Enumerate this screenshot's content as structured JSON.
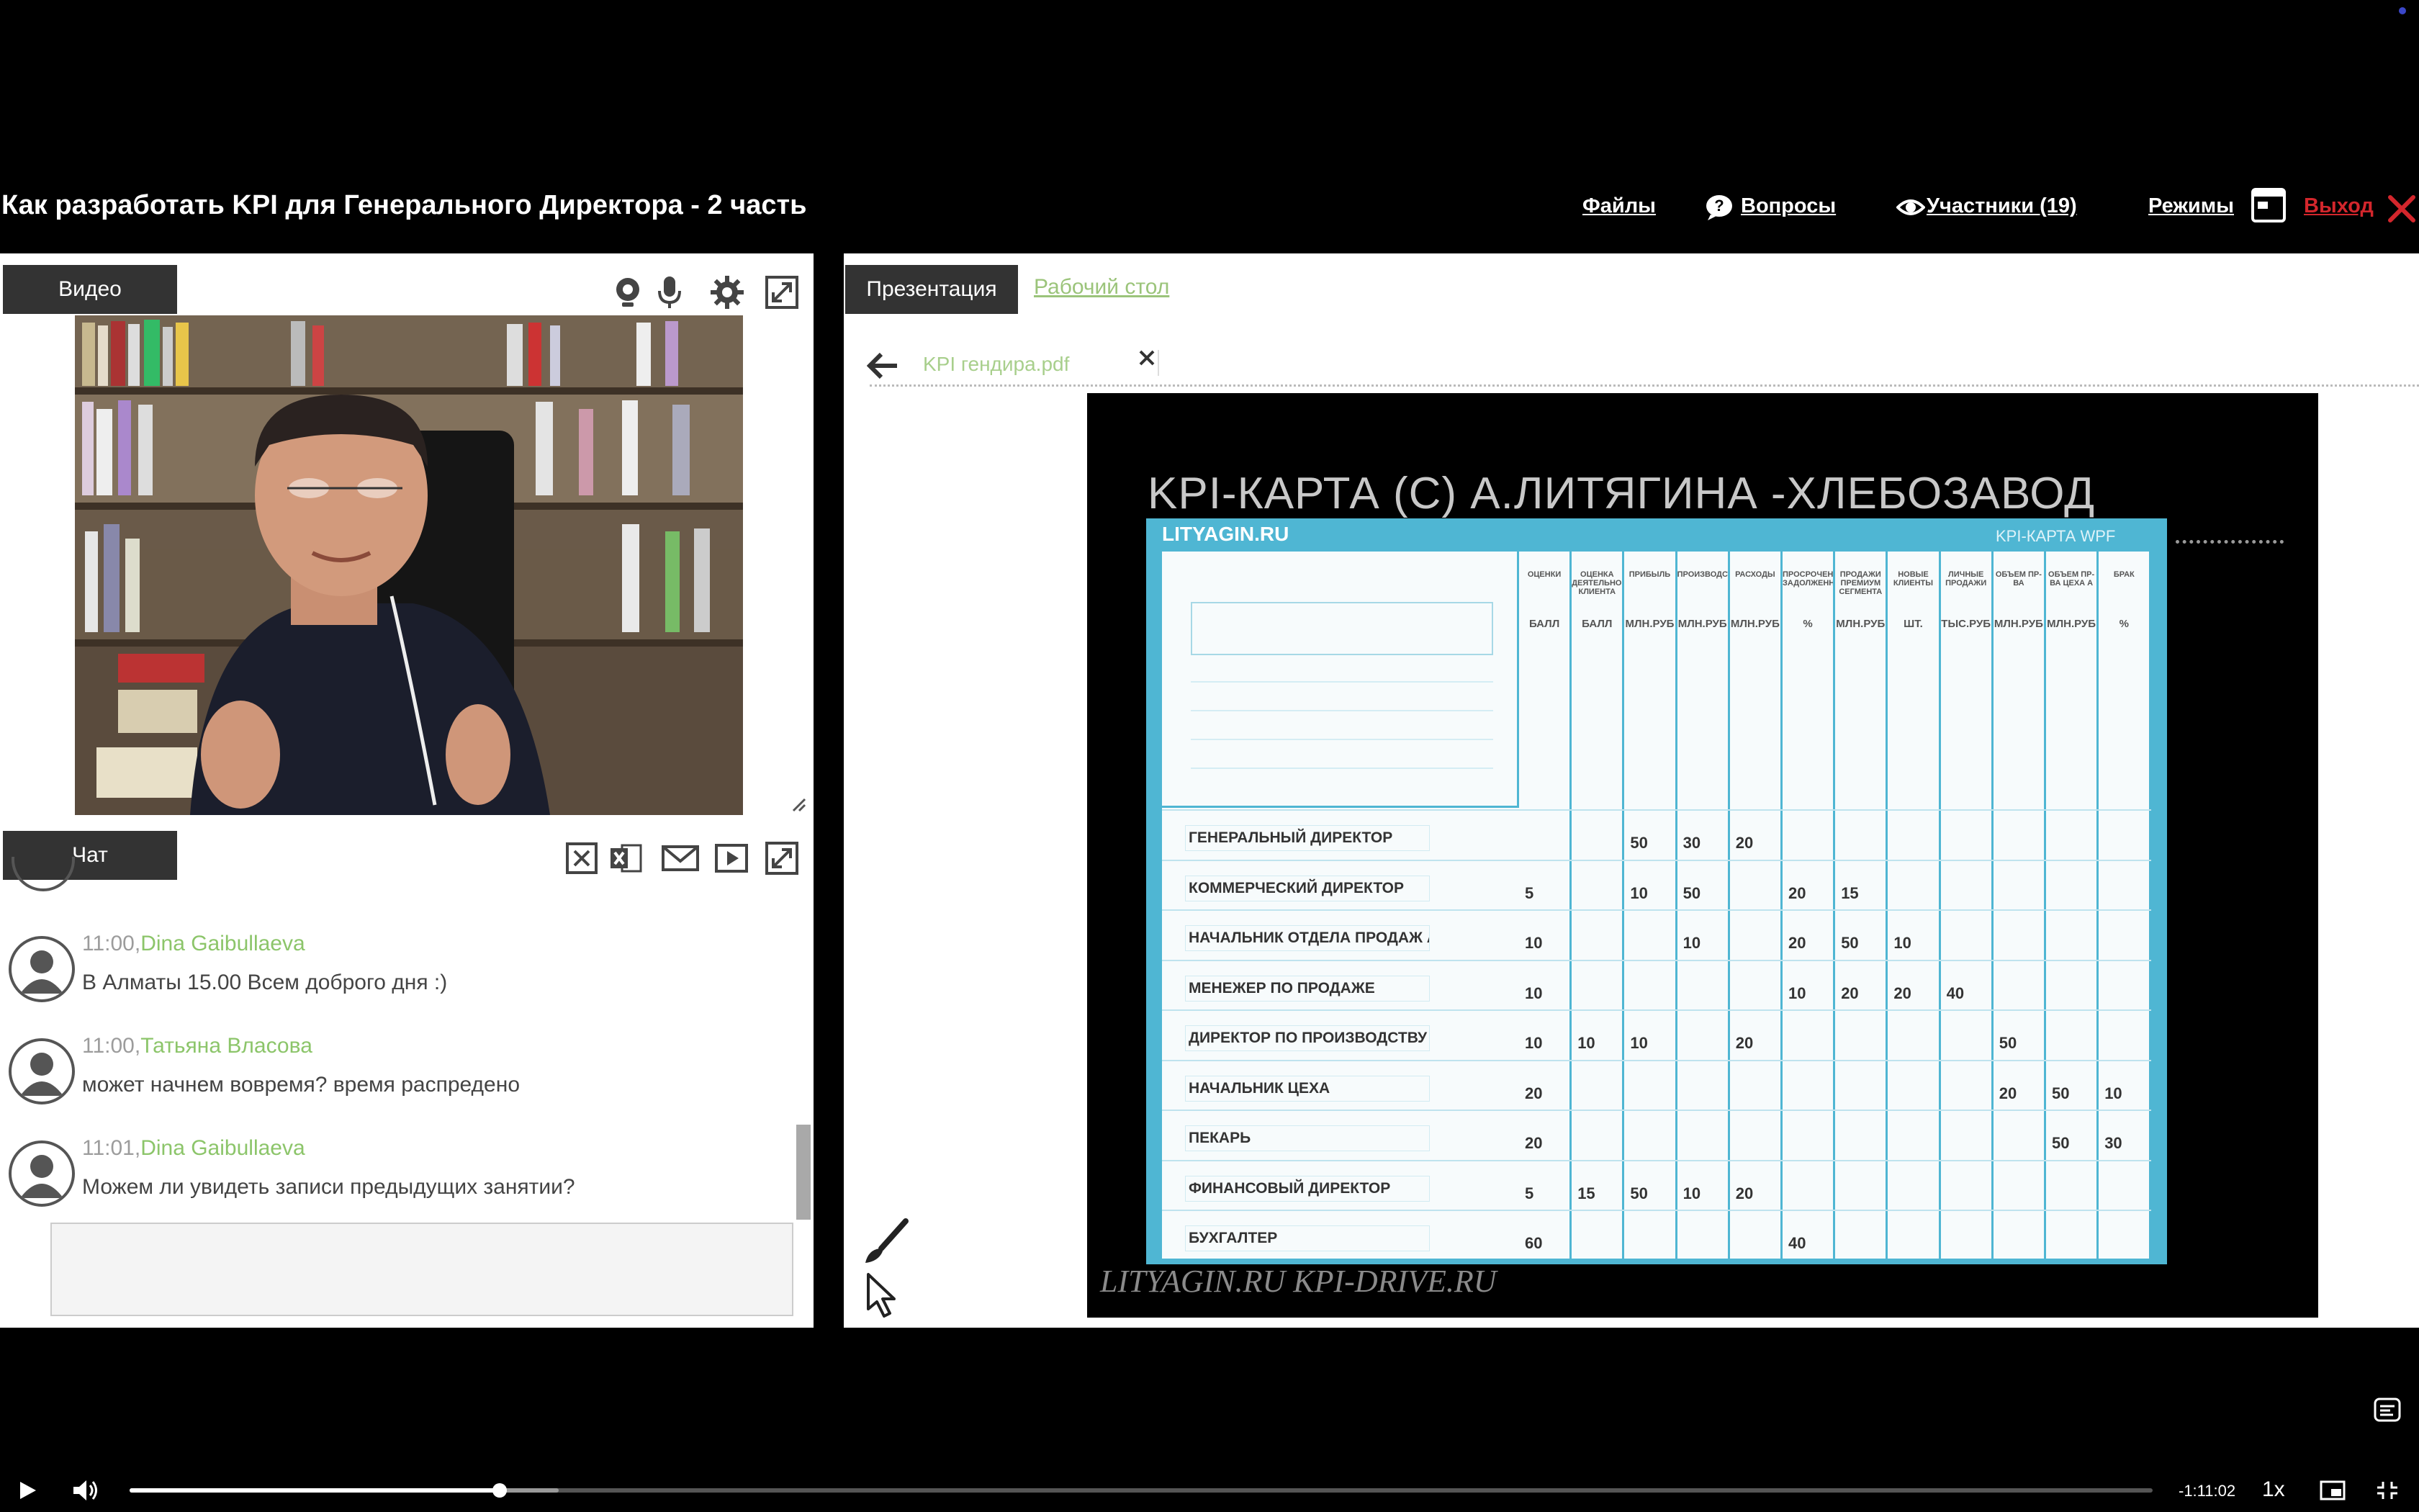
{
  "header": {
    "title": "Как разработать KPI для Генерального Директора - 2 часть",
    "nav": {
      "files": "Файлы",
      "questions": "Вопросы",
      "participants": "Участники (19)",
      "modes": "Режимы",
      "exit": "Выход"
    }
  },
  "video_panel": {
    "tab_label": "Видео"
  },
  "chat_panel": {
    "tab_label": "Чат",
    "messages": [
      {
        "time": "11:00,",
        "author": "Dina Gaibullaeva",
        "text": "В Алматы 15.00 Всем доброго дня :)"
      },
      {
        "time": "11:00,",
        "author": "Татьяна Власова",
        "text": "может начнем вовремя? время распредено"
      },
      {
        "time": "11:01,",
        "author": "Dina Gaibullaeva",
        "text": "Можем ли увидеть записи предыдущих занятии?"
      }
    ],
    "input_placeholder": ""
  },
  "presentation": {
    "tabs": {
      "presentation": "Презентация",
      "desktop": "Рабочий стол"
    },
    "file_name": "KPI гендира.pdf",
    "slide": {
      "title": "KPI-КАРТА (С) А.ЛИТЯГИНА -ХЛЕБОЗАВОД",
      "footer": "LITYAGIN.RU  KPI-DRIVE.RU",
      "card": {
        "logo": "LITYAGIN.RU",
        "badge": "KPI-КАРТА WPF",
        "columns": [
          {
            "head": "ОЦЕНКИ",
            "unit": "БАЛЛ"
          },
          {
            "head": "ОЦЕНКА ДЕЯТЕЛЬНОСТИ КЛИЕНТА",
            "unit": "БАЛЛ"
          },
          {
            "head": "ПРИБЫЛЬ",
            "unit": "МЛН.РУБ"
          },
          {
            "head": "ПРОИЗВОДСТВО",
            "unit": "МЛН.РУБ"
          },
          {
            "head": "РАСХОДЫ",
            "unit": "МЛН.РУБ"
          },
          {
            "head": "ПРОСРОЧЕННАЯ ЗАДОЛЖЕННОСТЬ",
            "unit": "%"
          },
          {
            "head": "ПРОДАЖИ ПРЕМИУМ СЕГМЕНТА",
            "unit": "МЛН.РУБ"
          },
          {
            "head": "НОВЫЕ КЛИЕНТЫ",
            "unit": "ШТ."
          },
          {
            "head": "ЛИЧНЫЕ ПРОДАЖИ",
            "unit": "ТЫС.РУБ"
          },
          {
            "head": "ОБЪЕМ ПР-ВА",
            "unit": "МЛН.РУБ"
          },
          {
            "head": "ОБЪЕМ ПР-ВА ЦЕХА А",
            "unit": "МЛН.РУБ"
          },
          {
            "head": "БРАК",
            "unit": "%"
          }
        ],
        "rows": [
          {
            "role": "ГЕНЕРАЛЬНЫЙ ДИРЕКТОР",
            "values": [
              "",
              "",
              "50",
              "30",
              "20",
              "",
              "",
              "",
              "",
              "",
              "",
              ""
            ]
          },
          {
            "role": "КОММЕРЧЕСКИЙ ДИРЕКТОР",
            "values": [
              "5",
              "",
              "10",
              "50",
              "",
              "20",
              "15",
              "",
              "",
              "",
              "",
              ""
            ]
          },
          {
            "role": "НАЧАЛЬНИК ОТДЕЛА ПРОДАЖ А",
            "values": [
              "10",
              "",
              "",
              "10",
              "",
              "20",
              "50",
              "10",
              "",
              "",
              "",
              ""
            ]
          },
          {
            "role": "МЕНЕЖЕР ПО ПРОДАЖЕ",
            "values": [
              "10",
              "",
              "",
              "",
              "",
              "10",
              "20",
              "20",
              "40",
              "",
              "",
              ""
            ]
          },
          {
            "role": "ДИРЕКТОР ПО ПРОИЗВОДСТВУ",
            "values": [
              "10",
              "10",
              "10",
              "",
              "20",
              "",
              "",
              "",
              "",
              "50",
              "",
              ""
            ]
          },
          {
            "role": "НАЧАЛЬНИК ЦЕХА",
            "values": [
              "20",
              "",
              "",
              "",
              "",
              "",
              "",
              "",
              "",
              "20",
              "50",
              "10"
            ]
          },
          {
            "role": "ПЕКАРЬ",
            "values": [
              "20",
              "",
              "",
              "",
              "",
              "",
              "",
              "",
              "",
              "",
              "50",
              "30"
            ]
          },
          {
            "role": "ФИНАНСОВЫЙ ДИРЕКТОР",
            "values": [
              "5",
              "15",
              "50",
              "10",
              "20",
              "",
              "",
              "",
              "",
              "",
              "",
              ""
            ]
          },
          {
            "role": "БУХГАЛТЕР",
            "values": [
              "60",
              "",
              "",
              "",
              "",
              "40",
              "",
              "",
              "",
              "",
              "",
              ""
            ]
          }
        ]
      }
    }
  },
  "player": {
    "time_remaining": "-1:11:02",
    "speed": "1x",
    "progress": 0.183,
    "buffered": 0.212
  },
  "colors": {
    "accent_green": "#8cc56a",
    "exit_red": "#d3262c",
    "card_blue": "#4fb6d3"
  }
}
